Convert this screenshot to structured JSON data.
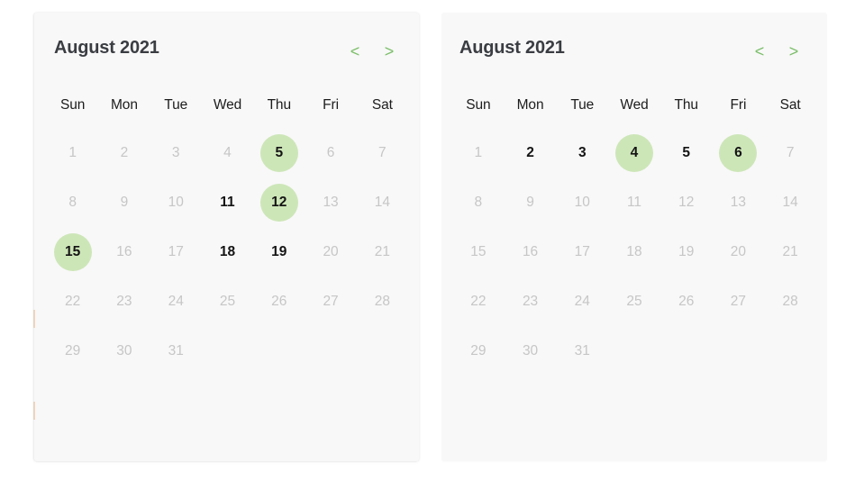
{
  "background_color": "#ffffff",
  "theme": {
    "card_background": "#f8f8f8",
    "selected_circle": "#cde6b8",
    "nav_arrow_color": "#7cbf6a",
    "enabled_text": "#141414",
    "disabled_text": "#c6c6c6",
    "title_text": "#3a3d42",
    "weekday_text": "#1c1c1c"
  },
  "weekdays": [
    "Sun",
    "Mon",
    "Tue",
    "Wed",
    "Thu",
    "Fri",
    "Sat"
  ],
  "calendars": [
    {
      "id": "calendar-left",
      "title": "August 2021",
      "month": "August",
      "year": "2021",
      "prev_label": "<",
      "next_label": ">",
      "prev_icon": "chevron-left-icon",
      "next_icon": "chevron-right-icon",
      "weeks": [
        [
          {
            "day": "1",
            "state": "disabled"
          },
          {
            "day": "2",
            "state": "disabled"
          },
          {
            "day": "3",
            "state": "disabled"
          },
          {
            "day": "4",
            "state": "disabled"
          },
          {
            "day": "5",
            "state": "selected"
          },
          {
            "day": "6",
            "state": "disabled"
          },
          {
            "day": "7",
            "state": "disabled"
          }
        ],
        [
          {
            "day": "8",
            "state": "disabled"
          },
          {
            "day": "9",
            "state": "disabled"
          },
          {
            "day": "10",
            "state": "disabled"
          },
          {
            "day": "11",
            "state": "enabled"
          },
          {
            "day": "12",
            "state": "selected"
          },
          {
            "day": "13",
            "state": "disabled"
          },
          {
            "day": "14",
            "state": "disabled"
          }
        ],
        [
          {
            "day": "15",
            "state": "selected"
          },
          {
            "day": "16",
            "state": "disabled"
          },
          {
            "day": "17",
            "state": "disabled"
          },
          {
            "day": "18",
            "state": "enabled"
          },
          {
            "day": "19",
            "state": "enabled"
          },
          {
            "day": "20",
            "state": "disabled"
          },
          {
            "day": "21",
            "state": "disabled"
          }
        ],
        [
          {
            "day": "22",
            "state": "disabled"
          },
          {
            "day": "23",
            "state": "disabled"
          },
          {
            "day": "24",
            "state": "disabled"
          },
          {
            "day": "25",
            "state": "disabled"
          },
          {
            "day": "26",
            "state": "disabled"
          },
          {
            "day": "27",
            "state": "disabled"
          },
          {
            "day": "28",
            "state": "disabled"
          }
        ],
        [
          {
            "day": "29",
            "state": "disabled"
          },
          {
            "day": "30",
            "state": "disabled"
          },
          {
            "day": "31",
            "state": "disabled"
          },
          {
            "day": "",
            "state": "empty"
          },
          {
            "day": "",
            "state": "empty"
          },
          {
            "day": "",
            "state": "empty"
          },
          {
            "day": "",
            "state": "empty"
          }
        ]
      ]
    },
    {
      "id": "calendar-right",
      "title": "August 2021",
      "month": "August",
      "year": "2021",
      "prev_label": "<",
      "next_label": ">",
      "prev_icon": "chevron-left-icon",
      "next_icon": "chevron-right-icon",
      "weeks": [
        [
          {
            "day": "1",
            "state": "disabled"
          },
          {
            "day": "2",
            "state": "enabled"
          },
          {
            "day": "3",
            "state": "enabled"
          },
          {
            "day": "4",
            "state": "selected"
          },
          {
            "day": "5",
            "state": "enabled"
          },
          {
            "day": "6",
            "state": "selected"
          },
          {
            "day": "7",
            "state": "disabled"
          }
        ],
        [
          {
            "day": "8",
            "state": "disabled"
          },
          {
            "day": "9",
            "state": "disabled"
          },
          {
            "day": "10",
            "state": "disabled"
          },
          {
            "day": "11",
            "state": "disabled"
          },
          {
            "day": "12",
            "state": "disabled"
          },
          {
            "day": "13",
            "state": "disabled"
          },
          {
            "day": "14",
            "state": "disabled"
          }
        ],
        [
          {
            "day": "15",
            "state": "disabled"
          },
          {
            "day": "16",
            "state": "disabled"
          },
          {
            "day": "17",
            "state": "disabled"
          },
          {
            "day": "18",
            "state": "disabled"
          },
          {
            "day": "19",
            "state": "disabled"
          },
          {
            "day": "20",
            "state": "disabled"
          },
          {
            "day": "21",
            "state": "disabled"
          }
        ],
        [
          {
            "day": "22",
            "state": "disabled"
          },
          {
            "day": "23",
            "state": "disabled"
          },
          {
            "day": "24",
            "state": "disabled"
          },
          {
            "day": "25",
            "state": "disabled"
          },
          {
            "day": "26",
            "state": "disabled"
          },
          {
            "day": "27",
            "state": "disabled"
          },
          {
            "day": "28",
            "state": "disabled"
          }
        ],
        [
          {
            "day": "29",
            "state": "disabled"
          },
          {
            "day": "30",
            "state": "disabled"
          },
          {
            "day": "31",
            "state": "disabled"
          },
          {
            "day": "",
            "state": "empty"
          },
          {
            "day": "",
            "state": "empty"
          },
          {
            "day": "",
            "state": "empty"
          },
          {
            "day": "",
            "state": "empty"
          }
        ]
      ]
    }
  ]
}
